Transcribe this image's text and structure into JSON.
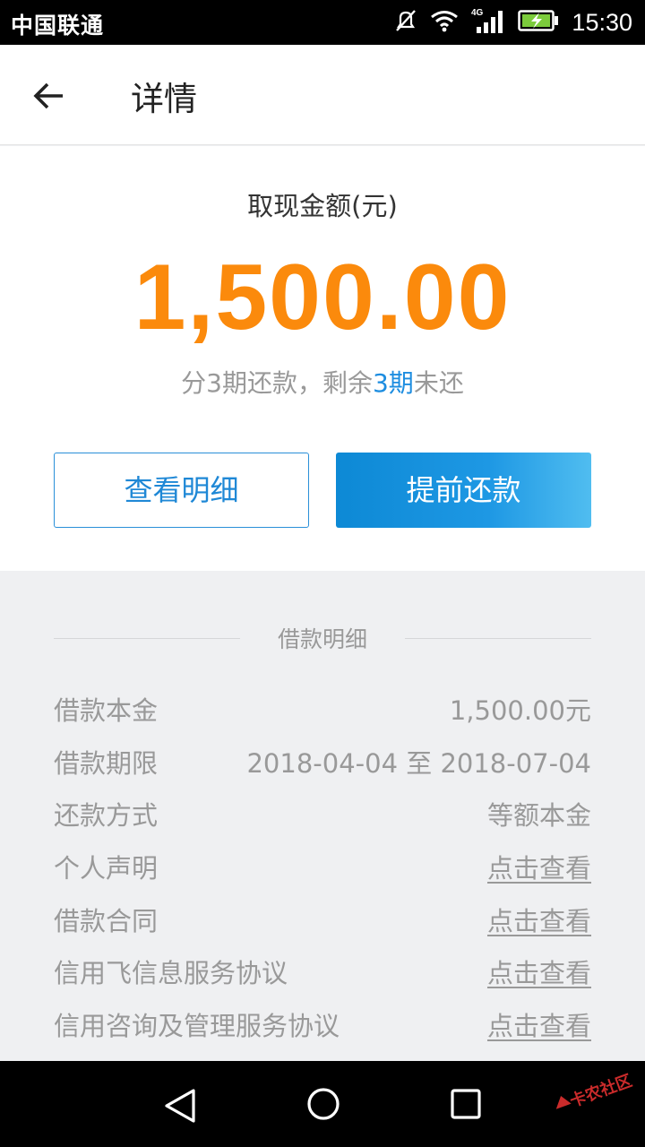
{
  "status_bar": {
    "carrier": "中国联通",
    "time": "15:30",
    "network": "4G"
  },
  "header": {
    "title": "详情"
  },
  "summary": {
    "amount_label": "取现金额(元)",
    "amount": "1,500.00",
    "installments_prefix": "分3期还款，剩余",
    "installments_highlight": "3期",
    "installments_suffix": "未还"
  },
  "actions": {
    "detail_label": "查看明细",
    "repay_label": "提前还款"
  },
  "loan_details": {
    "section_title": "借款明细",
    "rows": [
      {
        "label": "借款本金",
        "value": "1,500.00元"
      },
      {
        "label": "借款期限",
        "value": "2018-04-04 至 2018-07-04"
      },
      {
        "label": "还款方式",
        "value": "等额本金"
      },
      {
        "label": "个人声明",
        "value": "点击查看"
      },
      {
        "label": "借款合同",
        "value": "点击查看"
      },
      {
        "label": "信用飞信息服务协议",
        "value": "点击查看"
      },
      {
        "label": "信用咨询及管理服务协议",
        "value": "点击查看"
      }
    ]
  },
  "watermark": "卡农社区",
  "colors": {
    "accent_orange": "#fb8a0c",
    "accent_blue": "#1d8de0"
  }
}
